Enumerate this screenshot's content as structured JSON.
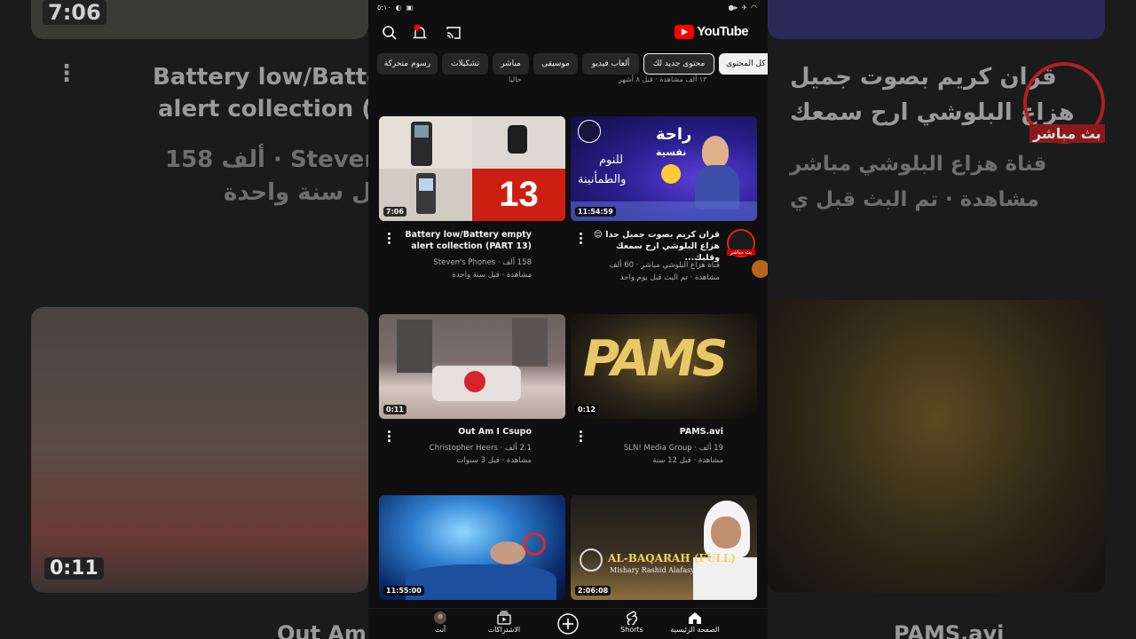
{
  "status": {
    "time": "٥:١٠"
  },
  "header": {
    "logo_text": "YouTube"
  },
  "chips": [
    "كل المحتوى",
    "محتوى جديد لك",
    "ألعاب فيديو",
    "موسيقى",
    "مباشر",
    "تشكيلات",
    "رسوم متحركة"
  ],
  "partial_row": {
    "left_meta": "حاليا",
    "right_meta": "١٣ ألف مشاهدة · قبل ٨ أشهر"
  },
  "videos": [
    {
      "title": "Battery low/Battery empty alert collection (PART 13)",
      "channel_line": "158 ألف · Steven's Phones",
      "age_line": "مشاهدة · قبل سنة واحدة",
      "duration": "7:06",
      "thumb_text": "13"
    },
    {
      "title": "قران كريم بصوت جميل جدا 😌 هزاع البلوشي ارح سمعك وقلبك...",
      "channel_line": "قناة هزاع البلوشي مباشر · 60 ألف",
      "age_line": "مشاهدة · تم البث قبل يوم واحد",
      "duration": "11:54:59",
      "thumb_text_1": "راحة",
      "thumb_text_2": "نفسية",
      "thumb_text_3": "للنوم",
      "thumb_text_4": "والطمأنينة",
      "live_badge": "بث مباشر"
    },
    {
      "title": "Out Am I Csupo",
      "channel_line": "2.1 ألف · Christopher Heers",
      "age_line": "مشاهدة · قبل 3 سنوات",
      "duration": "0:11"
    },
    {
      "title": "PAMS.avi",
      "channel_line": "19 ألف · SLN! Media Group",
      "age_line": "مشاهدة · قبل 12 سنة",
      "duration": "0:12",
      "thumb_text": "PAMS"
    },
    {
      "duration": "11:55:00"
    },
    {
      "duration": "2:06:08",
      "thumb_text_1": "AL-BAQARAH (FULL)",
      "thumb_text_2": "Mishary Rashid Alafasy"
    }
  ],
  "background": {
    "left_title_1": "Battery low/Batter",
    "left_title_2": "alert collection (PA",
    "left_meta_1": "158 ألف · Steven's",
    "left_meta_2": "قبل سنة واحدة",
    "left_duration_top": "7:06",
    "left_duration_bottom": "0:11",
    "left_bottom_title": "Out Am",
    "right_title_1": "قران كريم بصوت جميل",
    "right_title_2": "هزاع البلوشي ارح سمعك",
    "right_meta_1": "قناة هزاع البلوشي مباشر",
    "right_meta_2": "مشاهدة · تم البث قبل ي",
    "right_live": "بث مباشر",
    "right_bottom_title": "PAMS.avi"
  },
  "nav": {
    "home": "الصفحة الرئيسية",
    "shorts": "Shorts",
    "subscriptions": "الاشتراكات",
    "you": "أنت"
  },
  "colors": {
    "accent": "#ff0000",
    "bg": "#0f0f0f",
    "chip": "#272727"
  }
}
